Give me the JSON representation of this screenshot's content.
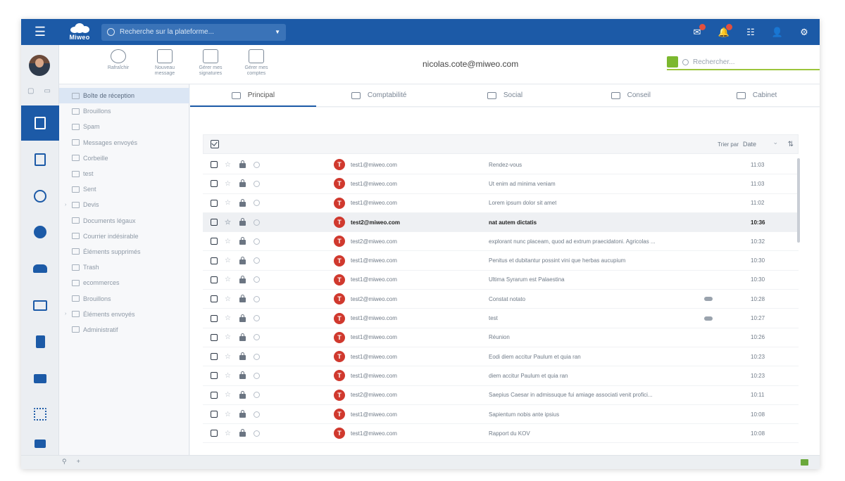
{
  "app": {
    "brand": "Miweo",
    "brand_color": "#1c5aa7"
  },
  "global_search": {
    "placeholder": "Recherche sur la plateforme..."
  },
  "top_icons": [
    "mail-notification-icon",
    "bell-notification-icon",
    "list-icon",
    "user-icon",
    "gear-icon"
  ],
  "rail": {
    "items": [
      "mail-icon",
      "calculator-icon",
      "contacts-icon",
      "info-icon",
      "users-icon",
      "id-card-icon",
      "document-icon",
      "briefcase-icon",
      "apps-grid-icon",
      "unlock-icon"
    ]
  },
  "toolbar": {
    "refresh": "Rafraîchir",
    "new_message_1": "Nouveau",
    "new_message_2": "message",
    "manage_signatures_1": "Gérer mes",
    "manage_signatures_2": "signatures",
    "manage_accounts_1": "Gérer mes",
    "manage_accounts_2": "comptes"
  },
  "account_email": "nicolas.cote@miweo.com",
  "local_search": {
    "placeholder": "Rechercher..."
  },
  "folders": [
    {
      "label": "Boîte de réception",
      "selected": true
    },
    {
      "label": "Brouillons"
    },
    {
      "label": "Spam"
    },
    {
      "label": "Messages envoyés"
    },
    {
      "label": "Corbeille"
    },
    {
      "label": "test"
    },
    {
      "label": "Sent"
    },
    {
      "label": "Devis",
      "expandable": true
    },
    {
      "label": "Documents légaux"
    },
    {
      "label": "Courrier indésirable"
    },
    {
      "label": "Éléments supprimés"
    },
    {
      "label": "Trash"
    },
    {
      "label": "ecommerces"
    },
    {
      "label": "Brouillons"
    },
    {
      "label": "Éléments envoyés",
      "expandable": true
    },
    {
      "label": "Administratif"
    }
  ],
  "tabs": [
    {
      "label": "Principal",
      "active": true
    },
    {
      "label": "Comptabilité"
    },
    {
      "label": "Social"
    },
    {
      "label": "Conseil"
    },
    {
      "label": "Cabinet"
    }
  ],
  "list": {
    "sort_label": "Trier par",
    "sort_value": "Date",
    "rows": [
      {
        "avatar": "T",
        "from": "test1@miweo.com",
        "subject": "Rendez-vous",
        "time": "11:03"
      },
      {
        "avatar": "T",
        "from": "test1@miweo.com",
        "subject": "Ut enim ad minima veniam",
        "time": "11:03"
      },
      {
        "avatar": "T",
        "from": "test1@miweo.com",
        "subject": "Lorem ipsum dolor sit amet",
        "time": "11:02"
      },
      {
        "avatar": "T",
        "from": "test2@miweo.com",
        "subject": "nat autem dictatis",
        "time": "10:36",
        "bold": true,
        "highlight": true
      },
      {
        "avatar": "T",
        "from": "test2@miweo.com",
        "subject": "explorant nunc placeam, quod ad extrum praecidatoni. Agricolas ...",
        "time": "10:32"
      },
      {
        "avatar": "T",
        "from": "test1@miweo.com",
        "subject": "Penitus et dubitantur possint vini que herbas aucupium",
        "time": "10:30"
      },
      {
        "avatar": "T",
        "from": "test1@miweo.com",
        "subject": "Ultima Syrarum est Palaestina",
        "time": "10:30"
      },
      {
        "avatar": "T",
        "from": "test2@miweo.com",
        "subject": "Constat notato",
        "time": "10:28",
        "attachment": true
      },
      {
        "avatar": "T",
        "from": "test1@miweo.com",
        "subject": "test",
        "time": "10:27",
        "attachment": true
      },
      {
        "avatar": "T",
        "from": "test1@miweo.com",
        "subject": "Réunion",
        "time": "10:26"
      },
      {
        "avatar": "T",
        "from": "test1@miweo.com",
        "subject": "Eodi diem accitur Paulum et quia ran",
        "time": "10:23"
      },
      {
        "avatar": "T",
        "from": "test1@miweo.com",
        "subject": "diem accitur Paulum et quia ran",
        "time": "10:23"
      },
      {
        "avatar": "T",
        "from": "test2@miweo.com",
        "subject": "Saepius Caesar in admissuque fui amiage associati venit profici...",
        "time": "10:11"
      },
      {
        "avatar": "T",
        "from": "test1@miweo.com",
        "subject": "Sapientum nobis ante ipsius",
        "time": "10:08"
      },
      {
        "avatar": "T",
        "from": "test1@miweo.com",
        "subject": "Rapport du KOV",
        "time": "10:08"
      }
    ]
  }
}
